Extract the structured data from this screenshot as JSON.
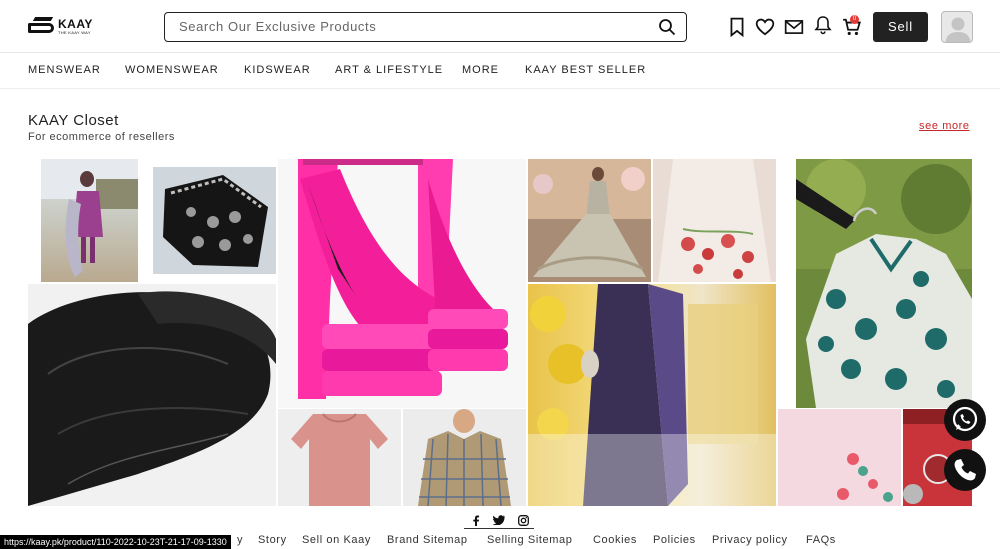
{
  "header": {
    "logo_title": "KAAY",
    "logo_tagline": "THE KAAY WAY",
    "search_placeholder": "Search Our Exclusive Products",
    "cart_count": "0",
    "sell_label": "Sell"
  },
  "nav": {
    "items": [
      "MENSWEAR",
      "WOMENSWEAR",
      "KIDSWEAR",
      "ART & LIFESTYLE",
      "MORE",
      "KAAY BEST SELLER"
    ]
  },
  "section": {
    "title": "KAAY Closet",
    "subtitle": "For ecommerce of resellers",
    "see_more": "see more"
  },
  "footer": {
    "links": [
      "y",
      "Story",
      "Sell on Kaay",
      "Brand Sitemap",
      "Selling Sitemap",
      "Cookies",
      "Policies",
      "Privacy policy",
      "FAQs"
    ]
  },
  "status_url": "https://kaay.pk/product/110-2022-10-23T-21-17-09-1330",
  "colors": {
    "accent": "#c62828",
    "badge": "#e53935",
    "dark": "#222222"
  }
}
